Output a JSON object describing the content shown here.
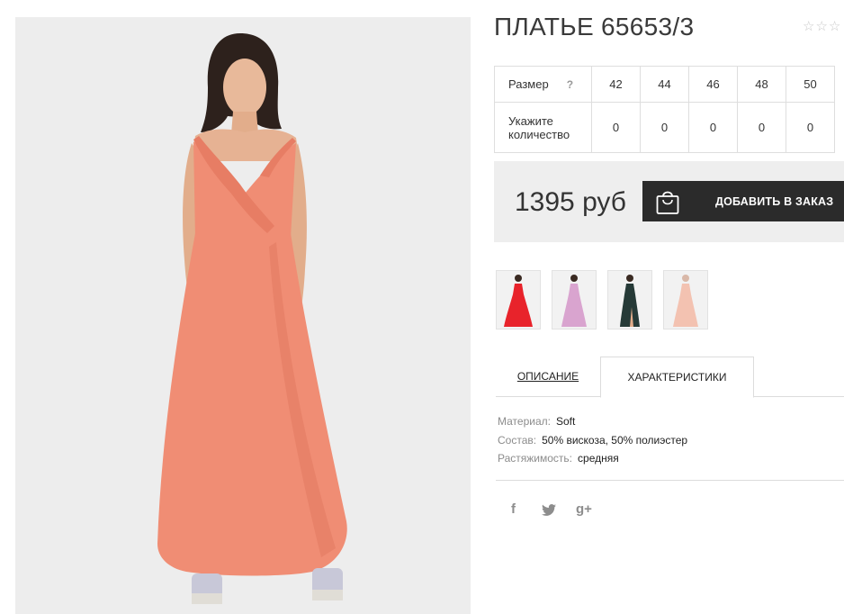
{
  "product": {
    "title": "ПЛАТЬЕ 65653/3",
    "rating_stars": "☆☆☆",
    "main_image_alt": ""
  },
  "sizes": {
    "size_label": "Размер",
    "help_label": "?",
    "qty_label_line1": "Укажите",
    "qty_label_line2": "количество",
    "values": [
      "42",
      "44",
      "46",
      "48",
      "50"
    ],
    "quantities": [
      "0",
      "0",
      "0",
      "0",
      "0"
    ]
  },
  "purchase": {
    "price": "1395 руб",
    "button_label": "ДОБАВИТЬ В ЗАКАЗ",
    "button_icon": "shopping-bag-icon"
  },
  "thumbnails": [
    {
      "color": "#e8232b"
    },
    {
      "color": "#d9a4cf"
    },
    {
      "color": "#263a37"
    },
    {
      "color": "#f3c2b1"
    }
  ],
  "tabs": {
    "description": "ОПИСАНИЕ",
    "characteristics": "ХАРАКТЕРИСТИКИ",
    "active": "characteristics"
  },
  "characteristics": [
    {
      "key": "Материал:",
      "value": "Soft"
    },
    {
      "key": "Состав:",
      "value": "50% вискоза, 50% полиэстер"
    },
    {
      "key": "Растяжимость:",
      "value": "средняя"
    }
  ],
  "social": {
    "facebook": "f",
    "twitter": "twitter-bird-icon",
    "google_plus": "g+"
  },
  "colors": {
    "dress": "#f08d74",
    "button_bg": "#2b2b2b",
    "price_bg": "#eeeeee"
  }
}
